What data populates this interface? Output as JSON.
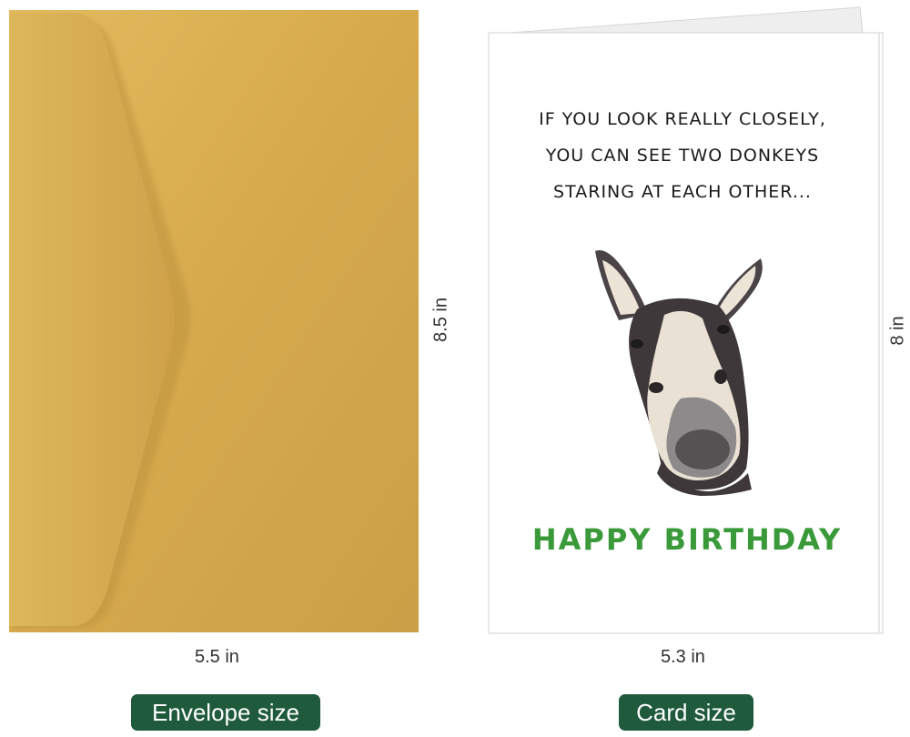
{
  "envelope": {
    "width_label": "5.5 in",
    "height_label": "8.5 in",
    "badge": "Envelope size",
    "color": "#d8ad4e"
  },
  "card": {
    "width_label": "5.3 in",
    "height_label": "8 in",
    "badge": "Card size",
    "text_lines": [
      "IF YOU LOOK REALLY CLOSELY,",
      "YOU CAN SEE TWO DONKEYS",
      "STARING AT EACH OTHER..."
    ],
    "greeting": "HAPPY BIRTHDAY",
    "greeting_color": "#3a9a3a"
  },
  "badge_color": "#1f5a3c"
}
